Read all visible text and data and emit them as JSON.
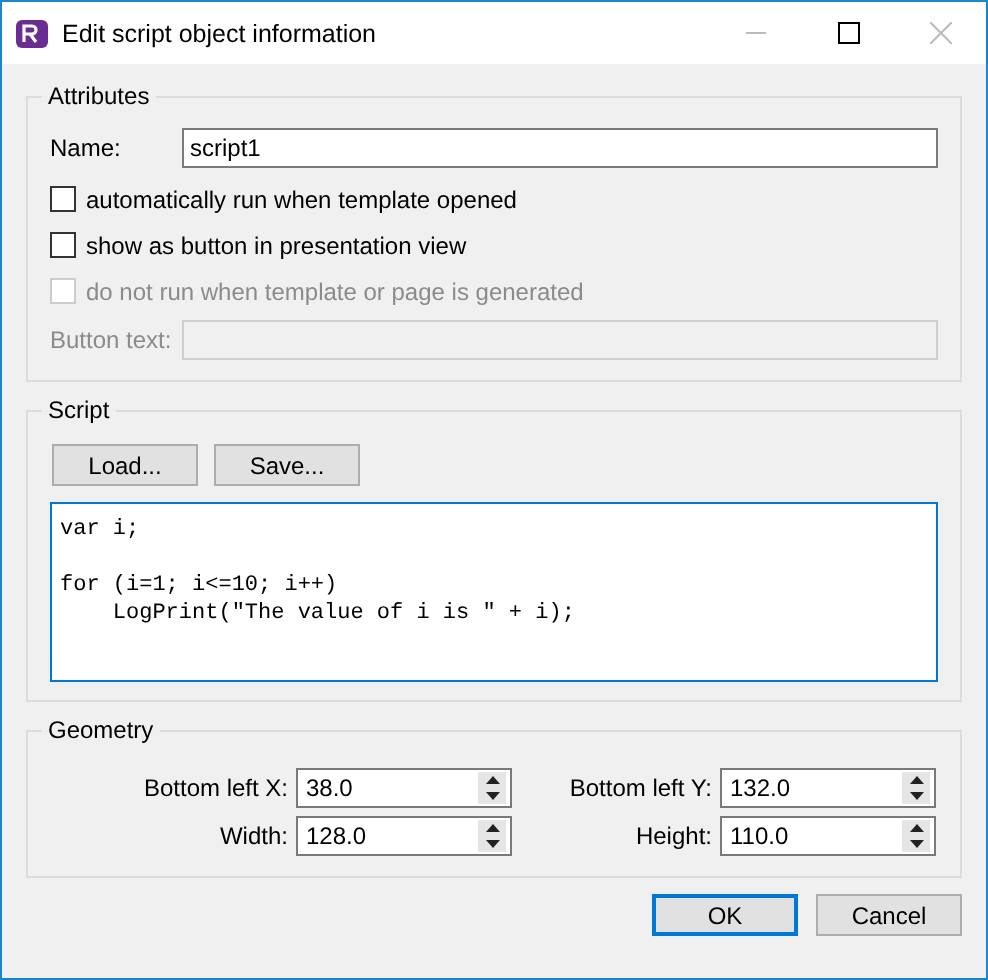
{
  "window": {
    "title": "Edit script object information"
  },
  "attributes": {
    "title": "Attributes",
    "name_label": "Name:",
    "name_value": "script1",
    "options": [
      {
        "label": "automatically run when template opened",
        "checked": false,
        "disabled": false
      },
      {
        "label": "show as button in presentation view",
        "checked": false,
        "disabled": false
      },
      {
        "label": "do not run when template or page is generated",
        "checked": false,
        "disabled": true
      }
    ],
    "button_text_label": "Button text:",
    "button_text_disabled": true
  },
  "script": {
    "title": "Script",
    "buttons": [
      "Load...",
      "Save..."
    ],
    "code": "var i;\n\nfor (i=1; i<=10; i++)\n    LogPrint(\"The value of i is \" + i);"
  },
  "geometry": {
    "title": "Geometry",
    "fields": [
      {
        "label": "Bottom left X:",
        "value": "38.0"
      },
      {
        "label": "Bottom left Y:",
        "value": "132.0"
      },
      {
        "label": "Width:",
        "value": "128.0"
      },
      {
        "label": "Height:",
        "value": "110.0"
      }
    ]
  },
  "buttons": [
    {
      "label": "OK",
      "default": true
    },
    {
      "label": "Cancel",
      "default": false
    }
  ]
}
